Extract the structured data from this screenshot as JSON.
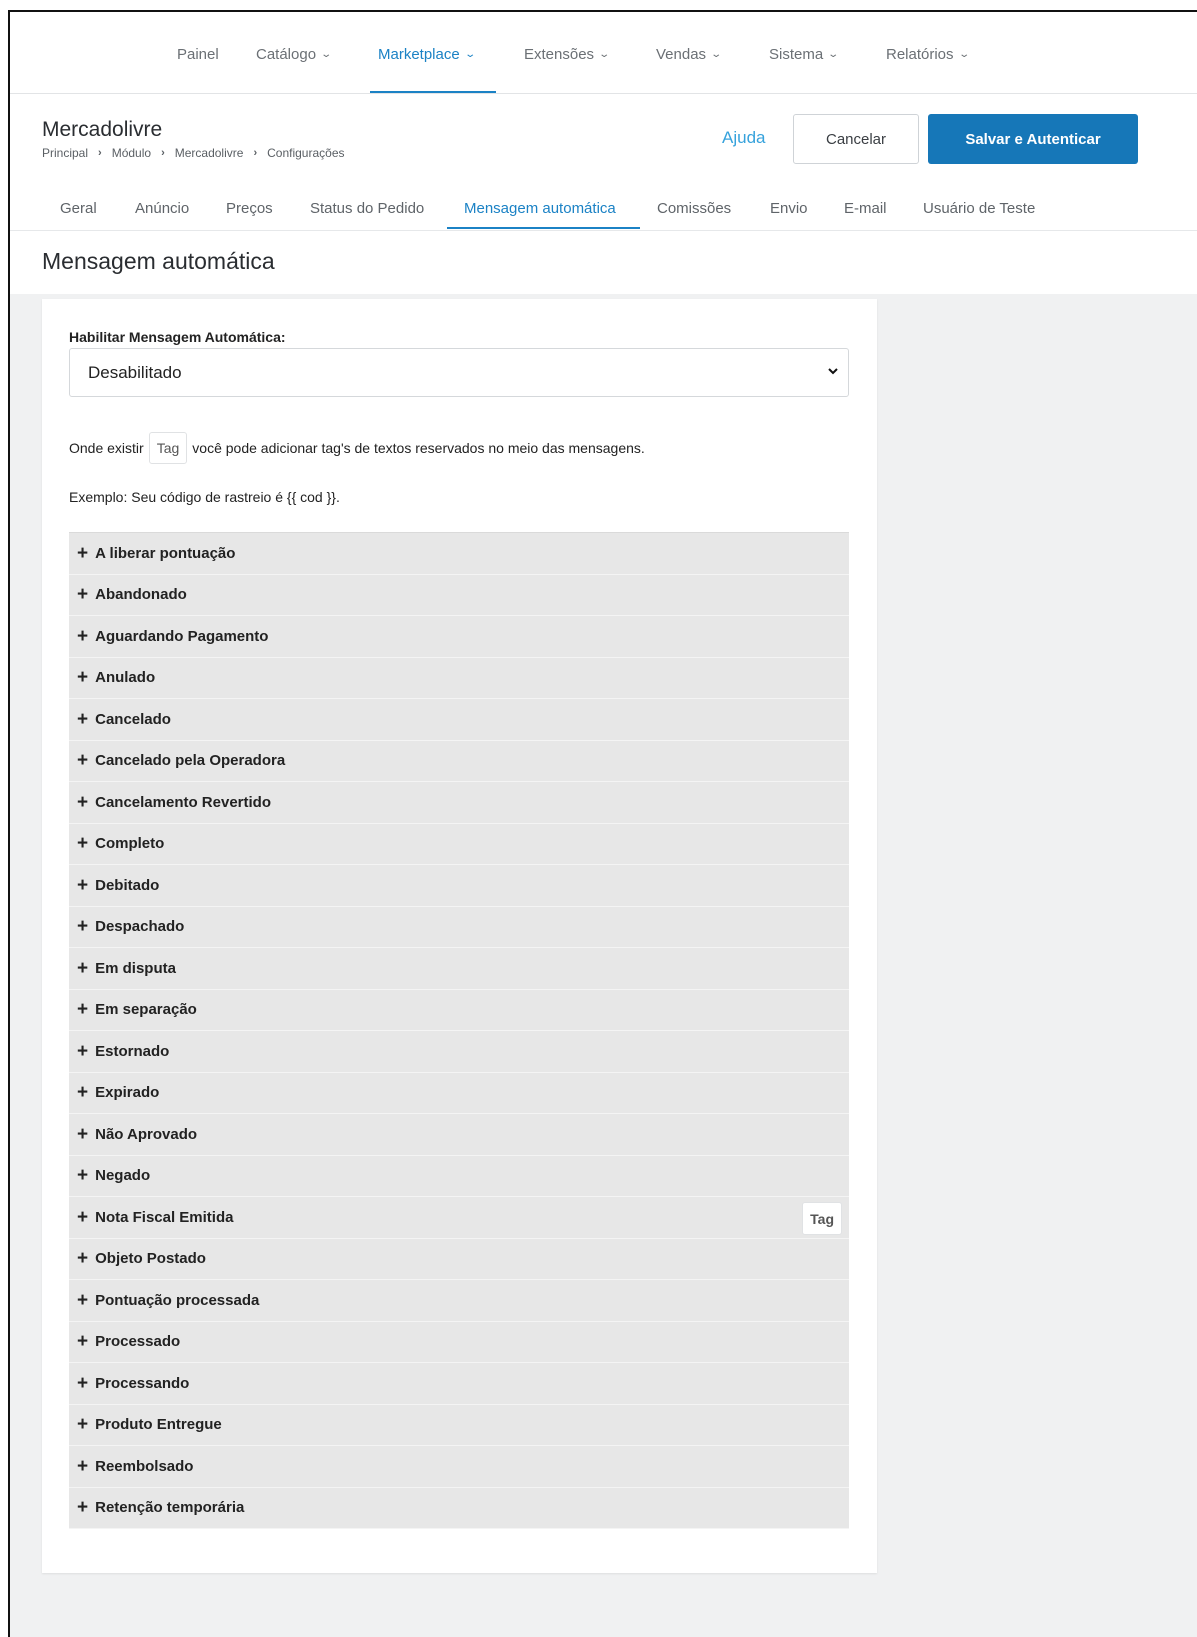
{
  "topnav": {
    "items": [
      {
        "label": "Painel",
        "has_chevron": false
      },
      {
        "label": "Catálogo",
        "has_chevron": true
      },
      {
        "label": "Marketplace",
        "has_chevron": true,
        "active": true
      },
      {
        "label": "Extensões",
        "has_chevron": true
      },
      {
        "label": "Vendas",
        "has_chevron": true
      },
      {
        "label": "Sistema",
        "has_chevron": true
      },
      {
        "label": "Relatórios",
        "has_chevron": true
      }
    ],
    "chevron_icon": "chevron-down-icon"
  },
  "header": {
    "title": "Mercadolivre",
    "breadcrumb": [
      "Principal",
      "Módulo",
      "Mercadolivre",
      "Configurações"
    ],
    "help_label": "Ajuda",
    "cancel_label": "Cancelar",
    "save_label": "Salvar e Autenticar"
  },
  "tabs": [
    {
      "label": "Geral"
    },
    {
      "label": "Anúncio"
    },
    {
      "label": "Preços"
    },
    {
      "label": "Status do Pedido"
    },
    {
      "label": "Mensagem automática",
      "active": true
    },
    {
      "label": "Comissões"
    },
    {
      "label": "Envio"
    },
    {
      "label": "E-mail"
    },
    {
      "label": "Usuário de Teste"
    }
  ],
  "main": {
    "section_title": "Mensagem automática",
    "enable_label": "Habilitar Mensagem Automática:",
    "enable_value": "Desabilitado",
    "info_prefix": "Onde existir",
    "info_tag": "Tag",
    "info_suffix": "você pode adicionar tag's de textos reservados no meio das mensagens.",
    "example": "Exemplo: Seu código de rastreio é {{ cod }}.",
    "statuses": [
      {
        "label": "A liberar pontuação"
      },
      {
        "label": "Abandonado"
      },
      {
        "label": "Aguardando Pagamento"
      },
      {
        "label": "Anulado"
      },
      {
        "label": "Cancelado"
      },
      {
        "label": "Cancelado pela Operadora"
      },
      {
        "label": "Cancelamento Revertido"
      },
      {
        "label": "Completo"
      },
      {
        "label": "Debitado"
      },
      {
        "label": "Despachado"
      },
      {
        "label": "Em disputa"
      },
      {
        "label": "Em separação"
      },
      {
        "label": "Estornado"
      },
      {
        "label": "Expirado"
      },
      {
        "label": "Não Aprovado"
      },
      {
        "label": "Negado"
      },
      {
        "label": "Nota Fiscal Emitida",
        "tag": "Tag"
      },
      {
        "label": "Objeto Postado"
      },
      {
        "label": "Pontuação processada"
      },
      {
        "label": "Processado"
      },
      {
        "label": "Processando"
      },
      {
        "label": "Produto Entregue"
      },
      {
        "label": "Reembolsado"
      },
      {
        "label": "Retenção temporária"
      }
    ],
    "plus_icon": "plus-icon"
  },
  "colors": {
    "accent": "#1b82c5",
    "primary_button": "#1677b8",
    "help_link": "#36a2dc",
    "accordion_bg": "#e7e7e7"
  }
}
